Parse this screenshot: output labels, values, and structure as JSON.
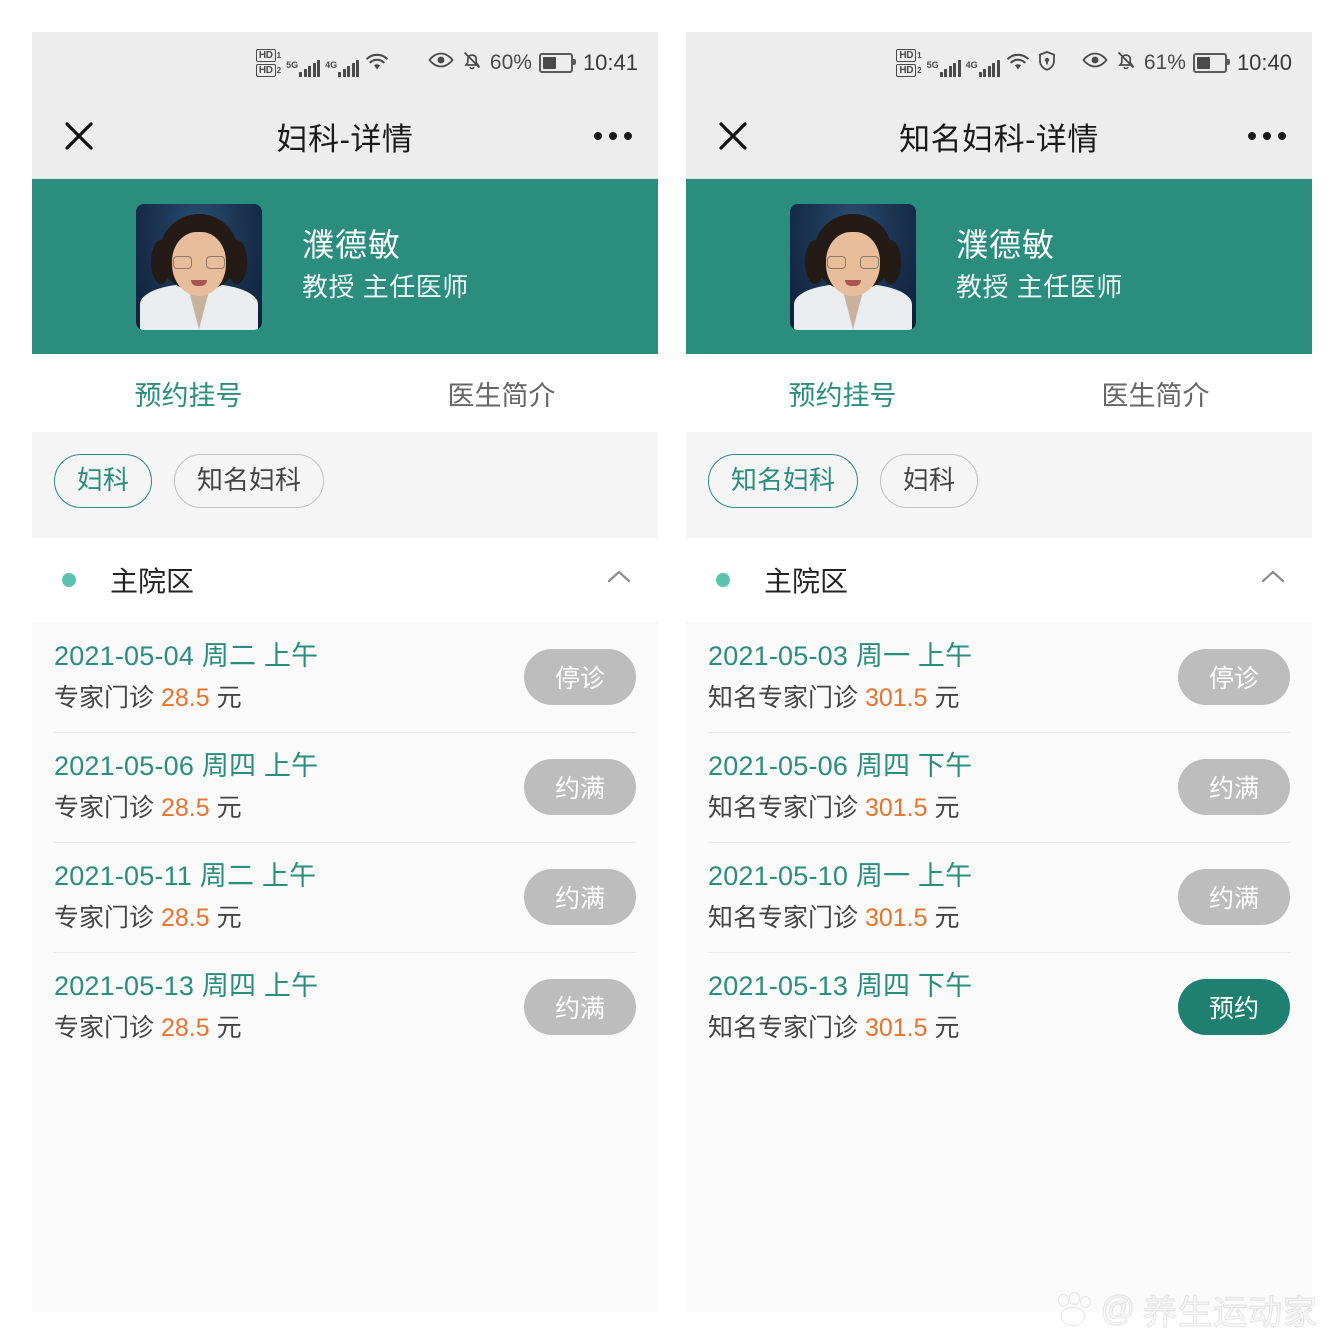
{
  "panels": [
    {
      "status": {
        "hd1": "HD",
        "hd1_sub": "1",
        "hd2": "HD",
        "hd2_sub": "2",
        "net1": "5G",
        "net2": "4G",
        "wifi_icon": "wifi-icon",
        "eye_icon": "eye-comfort-icon",
        "mute_icon": "bell-muted-icon",
        "battery_pct": "60%",
        "time": "10:41"
      },
      "nav": {
        "close_icon": "close-icon",
        "title": "妇科-详情",
        "more_icon": "more-options-icon"
      },
      "doctor": {
        "name": "濮德敏",
        "title": "教授 主任医师",
        "avatar_icon": "doctor-avatar"
      },
      "tabs": [
        {
          "label": "预约挂号",
          "active": true
        },
        {
          "label": "医生简介",
          "active": false
        }
      ],
      "chips": [
        {
          "label": "妇科",
          "active": true
        },
        {
          "label": "知名妇科",
          "active": false
        }
      ],
      "section": {
        "dot_icon": "status-dot-icon",
        "label": "主院区",
        "chevron_icon": "chevron-up-icon"
      },
      "schedule": [
        {
          "date": "2021-05-04 周二 上午",
          "clinic": "专家门诊",
          "price": "28.5",
          "unit": "元",
          "status": "停诊",
          "state": "disabled"
        },
        {
          "date": "2021-05-06 周四 上午",
          "clinic": "专家门诊",
          "price": "28.5",
          "unit": "元",
          "status": "约满",
          "state": "disabled"
        },
        {
          "date": "2021-05-11 周二 上午",
          "clinic": "专家门诊",
          "price": "28.5",
          "unit": "元",
          "status": "约满",
          "state": "disabled"
        },
        {
          "date": "2021-05-13 周四 上午",
          "clinic": "专家门诊",
          "price": "28.5",
          "unit": "元",
          "status": "约满",
          "state": "disabled"
        }
      ]
    },
    {
      "status": {
        "hd1": "HD",
        "hd1_sub": "1",
        "hd2": "HD",
        "hd2_sub": "2",
        "net1": "5G",
        "net2": "4G",
        "wifi_icon": "wifi-icon",
        "vpn_icon": "vpn-shield-icon",
        "eye_icon": "eye-comfort-icon",
        "mute_icon": "bell-muted-icon",
        "battery_pct": "61%",
        "time": "10:40"
      },
      "nav": {
        "close_icon": "close-icon",
        "title": "知名妇科-详情",
        "more_icon": "more-options-icon"
      },
      "doctor": {
        "name": "濮德敏",
        "title": "教授 主任医师",
        "avatar_icon": "doctor-avatar"
      },
      "tabs": [
        {
          "label": "预约挂号",
          "active": true
        },
        {
          "label": "医生简介",
          "active": false
        }
      ],
      "chips": [
        {
          "label": "知名妇科",
          "active": true
        },
        {
          "label": "妇科",
          "active": false
        }
      ],
      "section": {
        "dot_icon": "status-dot-icon",
        "label": "主院区",
        "chevron_icon": "chevron-up-icon"
      },
      "schedule": [
        {
          "date": "2021-05-03 周一 上午",
          "clinic": "知名专家门诊",
          "price": "301.5",
          "unit": "元",
          "status": "停诊",
          "state": "disabled"
        },
        {
          "date": "2021-05-06 周四 下午",
          "clinic": "知名专家门诊",
          "price": "301.5",
          "unit": "元",
          "status": "约满",
          "state": "disabled"
        },
        {
          "date": "2021-05-10 周一 上午",
          "clinic": "知名专家门诊",
          "price": "301.5",
          "unit": "元",
          "status": "约满",
          "state": "disabled"
        },
        {
          "date": "2021-05-13 周四 下午",
          "clinic": "知名专家门诊",
          "price": "301.5",
          "unit": "元",
          "status": "预约",
          "state": "book"
        }
      ]
    }
  ],
  "watermark": {
    "logo_icon": "baidu-paw-icon",
    "at": "@",
    "text": "养生运动家"
  },
  "colors": {
    "brand_green": "#2a8d7e",
    "book_green": "#1f8070",
    "price_orange": "#e8732c",
    "disabled_gray": "#bdbdbd",
    "dot_teal": "#5bc4b0"
  }
}
